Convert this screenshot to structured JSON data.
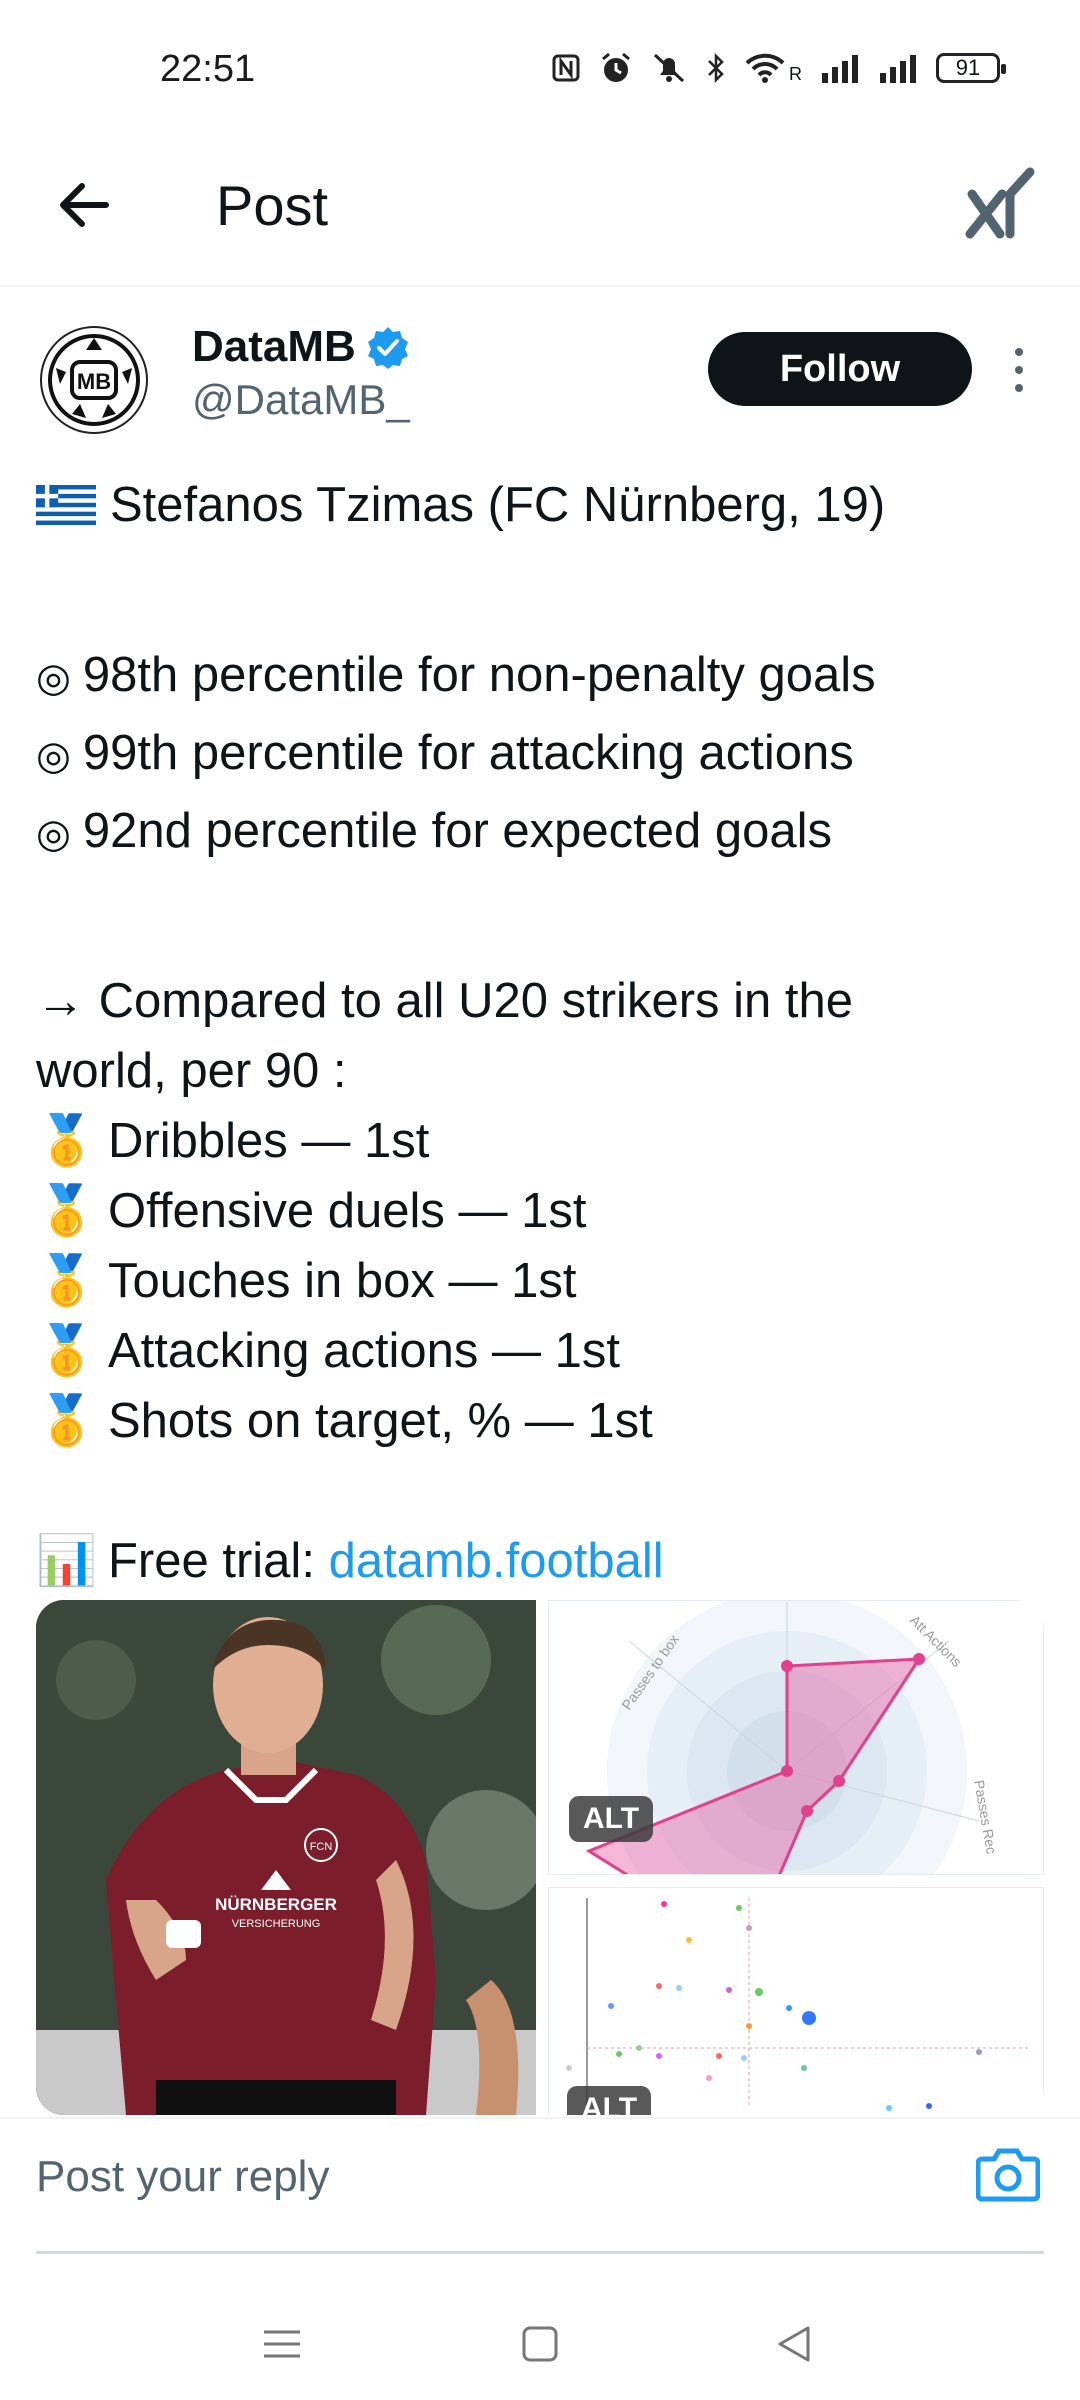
{
  "status_bar": {
    "time": "22:51",
    "network_label": "R",
    "battery": "91"
  },
  "header": {
    "title": "Post"
  },
  "post": {
    "author_name": "DataMB",
    "author_handle": "@DataMB_",
    "follow_label": "Follow",
    "avatar_text": "MB",
    "title_line": "Stefanos Tzimas (FC Nürnberg, 19)",
    "bullet_symbol": "◎",
    "percentiles": [
      "98th percentile for non-penalty goals",
      "99th percentile for attacking actions",
      "92nd percentile for expected goals"
    ],
    "compare_line_1": "→ Compared to all U20 strikers in the",
    "compare_line_2": "world, per 90 :",
    "medal_symbol": "🥇",
    "rankings": [
      "Dribbles — 1st",
      "Offensive duels — 1st",
      "Touches in box — 1st",
      "Attacking actions — 1st",
      "Shots on target, % — 1st"
    ],
    "trial_icon": "📊",
    "trial_label": "Free trial: ",
    "trial_link": "datamb.football"
  },
  "media": {
    "photo_sponsor_1": "NÜRNBERGER",
    "photo_sponsor_2": "VERSICHERUNG",
    "photo_crest": "FCN",
    "radar_labels": [
      "Passes to box",
      "Att Actions",
      "Passes Rec"
    ],
    "alt_label": "ALT"
  },
  "reply": {
    "placeholder": "Post your reply"
  },
  "colors": {
    "link": "#1d9bf0",
    "verified": "#1d9bf0",
    "radar_fill": "#e75fa3",
    "follow_bg": "#0f1419"
  }
}
